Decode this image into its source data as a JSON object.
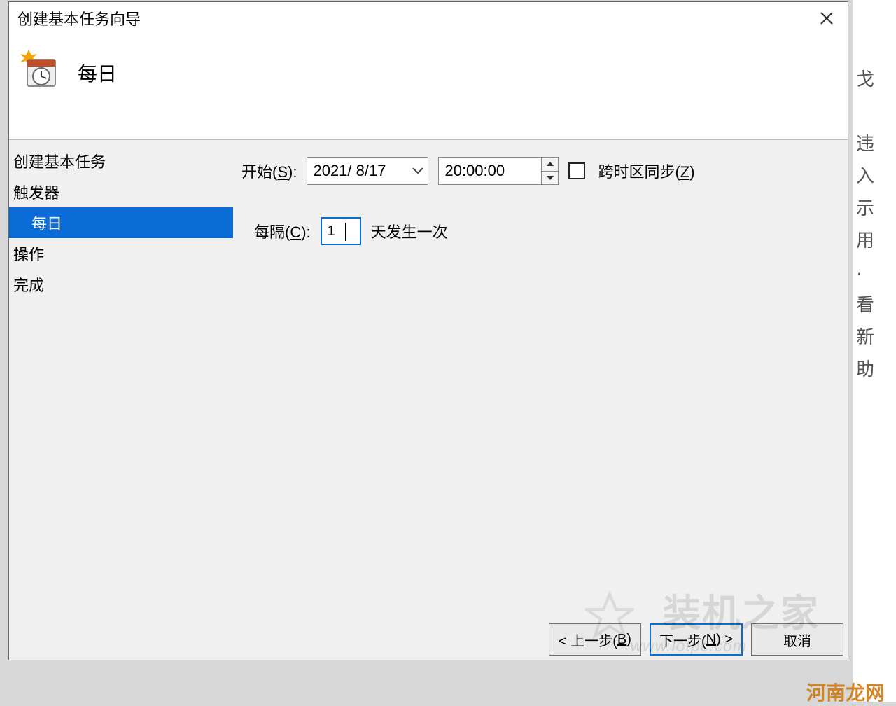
{
  "window": {
    "title": "创建基本任务向导"
  },
  "banner": {
    "heading": "每日"
  },
  "sidebar": {
    "steps": [
      {
        "label": "创建基本任务",
        "selected": false,
        "sub": false
      },
      {
        "label": "触发器",
        "selected": false,
        "sub": false
      },
      {
        "label": "每日",
        "selected": true,
        "sub": true
      },
      {
        "label": "操作",
        "selected": false,
        "sub": false
      },
      {
        "label": "完成",
        "selected": false,
        "sub": false
      }
    ]
  },
  "form": {
    "start_label_pre": "开始(",
    "start_label_u": "S",
    "start_label_post": "):",
    "date_value": "2021/ 8/17",
    "time_value": "20:00:00",
    "sync_label_pre": "跨时区同步(",
    "sync_label_u": "Z",
    "sync_label_post": ")",
    "sync_checked": false,
    "recur_label_pre": "每隔(",
    "recur_label_u": "C",
    "recur_label_post": "):",
    "recur_value": "1",
    "recur_suffix": "天发生一次"
  },
  "footer": {
    "back_pre": "< 上一步(",
    "back_u": "B",
    "back_post": ")",
    "next_pre": "下一步(",
    "next_u": "N",
    "next_post": ") >",
    "cancel": "取消"
  },
  "watermark": {
    "brand": "装机之家",
    "url": "www.lotpc.com",
    "site": "河南龙网"
  },
  "bg_chars": "戈\n\n违\n入\n示\n用\n·\n看\n新\n助"
}
